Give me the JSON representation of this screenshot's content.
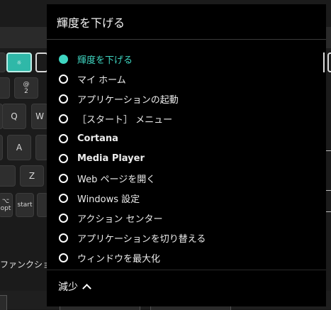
{
  "dropdown": {
    "title": "輝度を下げる",
    "options": [
      {
        "label": "輝度を下げる",
        "selected": true
      },
      {
        "label": "マイ ホーム",
        "selected": false
      },
      {
        "label": "アプリケーションの起動",
        "selected": false
      },
      {
        "label": "［スタート］ メニュー",
        "selected": false
      },
      {
        "label": "Cortana",
        "selected": false
      },
      {
        "label": "Media Player",
        "selected": false
      },
      {
        "label": "Web ページを開く",
        "selected": false
      },
      {
        "label": "Windows 設定",
        "selected": false
      },
      {
        "label": "アクション センター",
        "selected": false
      },
      {
        "label": "アプリケーションを切り替える",
        "selected": false
      },
      {
        "label": "ウィンドウを最大化",
        "selected": false
      }
    ],
    "less_label": "減少"
  },
  "background": {
    "keys": {
      "q": "Q",
      "w": "W",
      "a": "A",
      "z": "Z",
      "at_top": "@",
      "at_bottom": "2",
      "opt_top": "⌥",
      "opt_bottom": "opt",
      "start": "start",
      "highlight": "☼"
    },
    "function_label": "ファンクションキ"
  },
  "colors": {
    "accent": "#3fd6c2",
    "highlight_key": "#2fb8a8",
    "panel_bg": "#000000"
  }
}
